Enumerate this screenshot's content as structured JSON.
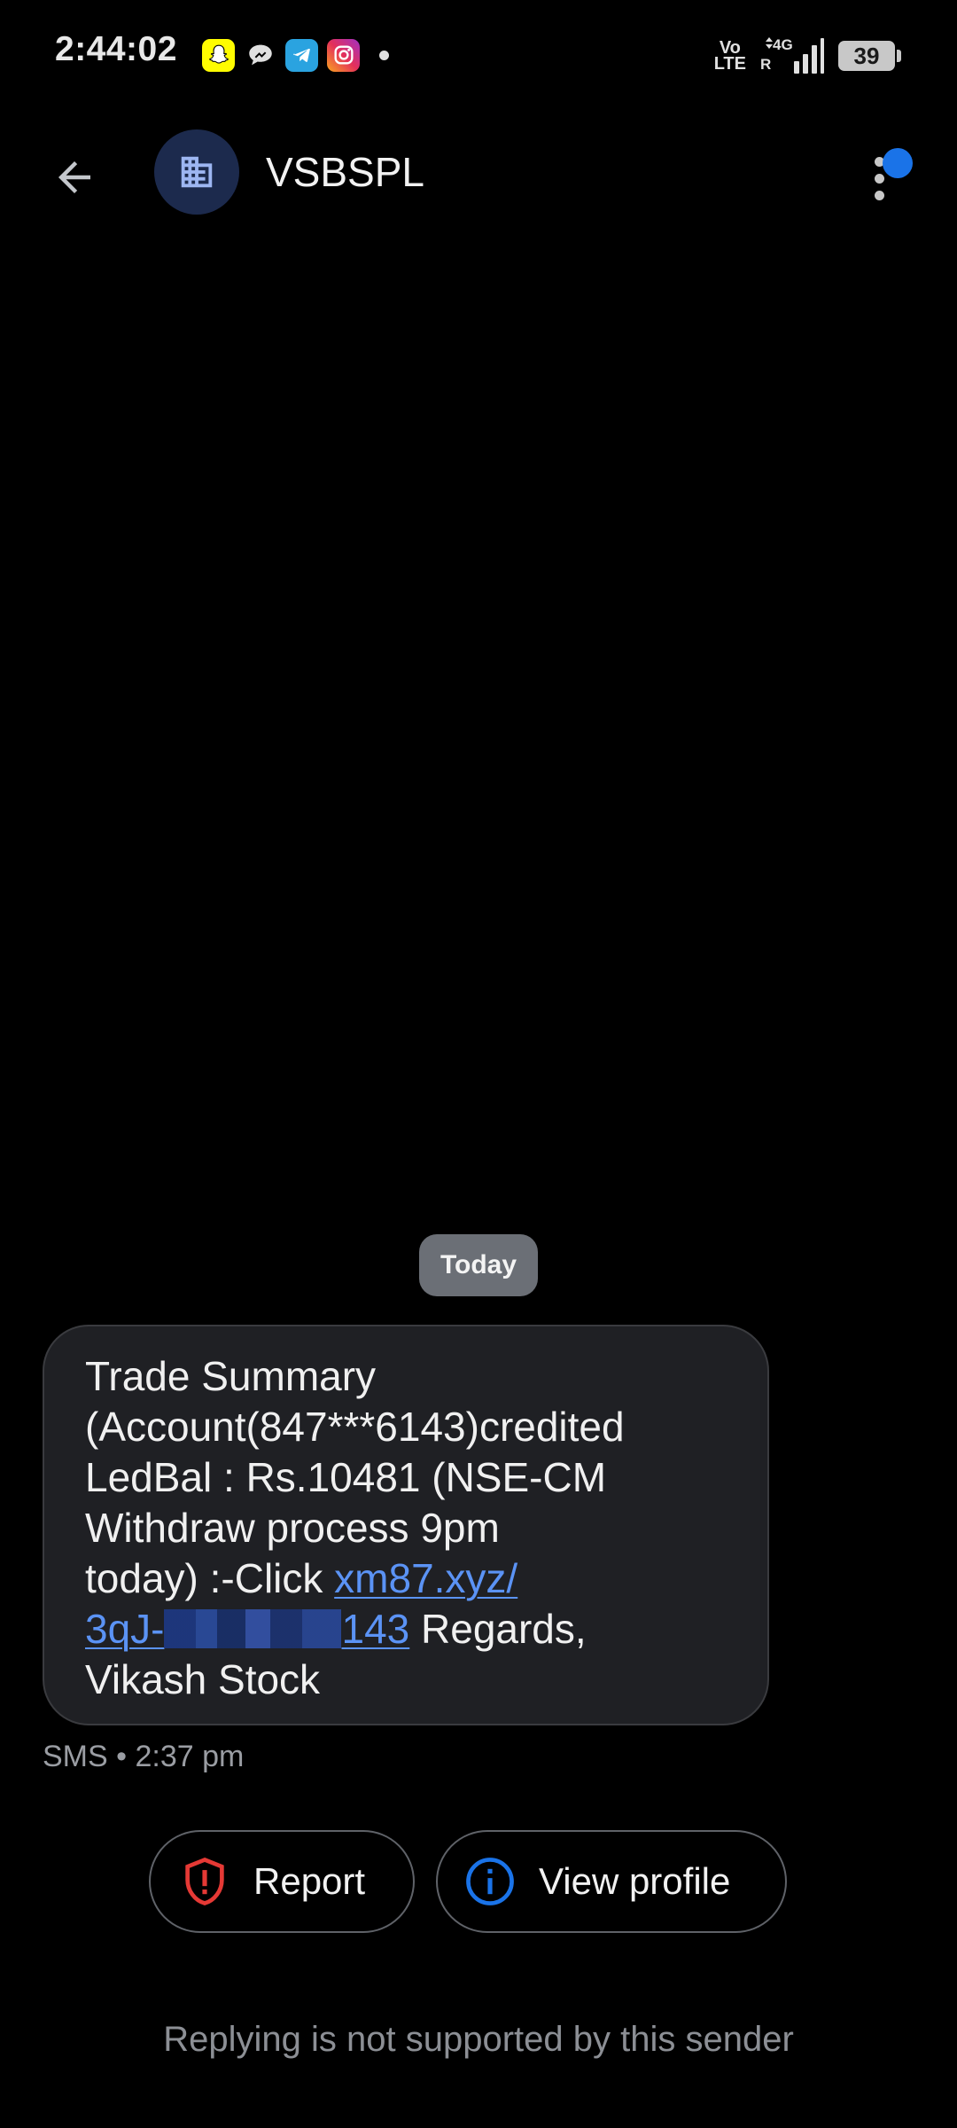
{
  "status_bar": {
    "time": "2:44:02",
    "network_label": "Vo LTE",
    "volte_top": "Vo",
    "volte_bottom": "LTE",
    "network_type": "4G",
    "roaming": "R",
    "battery": "39",
    "notification_icons": [
      "snapchat-icon",
      "chat-bubble-icon",
      "telegram-icon",
      "instagram-icon",
      "more-dot"
    ]
  },
  "header": {
    "sender": "VSBSPL",
    "avatar_icon": "business-building-icon",
    "has_unread_badge": true
  },
  "conversation": {
    "date_label": "Today",
    "message": {
      "line1": "Trade Summary",
      "line2": "(Account(847***6143)credited",
      "line3": "LedBal : Rs.10481 (NSE-CM",
      "line4": "Withdraw process 9pm",
      "line5_text": "today) :-Click ",
      "link_part1": "xm87.xyz/",
      "link_part2_start": "3qJ-",
      "link_part2_end": "143",
      "line6_text": " Regards,",
      "line7": "Vikash Stock",
      "meta": "SMS • 2:37 pm"
    }
  },
  "actions": {
    "report_label": "Report",
    "view_profile_label": "View profile"
  },
  "footer": {
    "note": "Replying is not supported by this sender"
  },
  "colors": {
    "background": "#000000",
    "bubble": "#1f2024",
    "link": "#5b93f5",
    "report_red": "#e53935",
    "info_blue": "#1a73e8",
    "accent_badge": "#1a73e8"
  }
}
